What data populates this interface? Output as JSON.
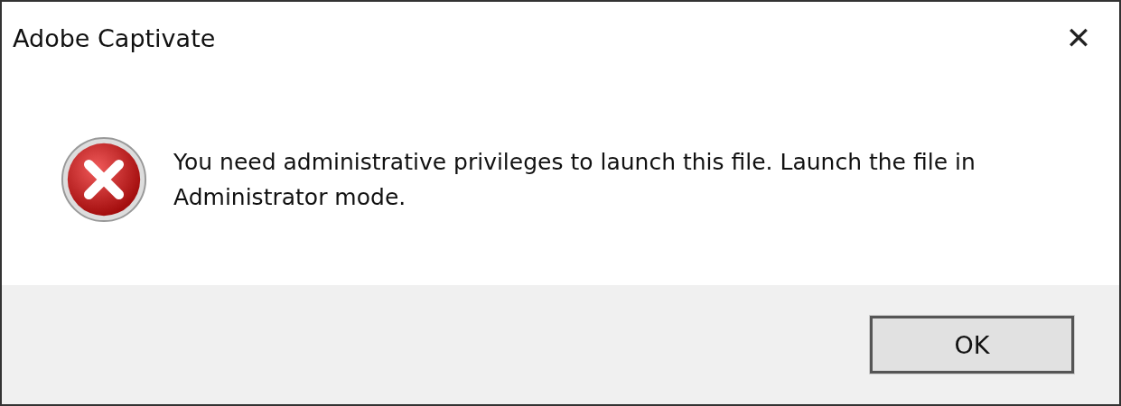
{
  "window": {
    "title": "Adobe Captivate",
    "close": "✕"
  },
  "message": "You need administrative privileges to launch this file. Launch the file in Administrator mode.",
  "buttons": [
    {
      "label": "OK",
      "selected": true
    }
  ]
}
